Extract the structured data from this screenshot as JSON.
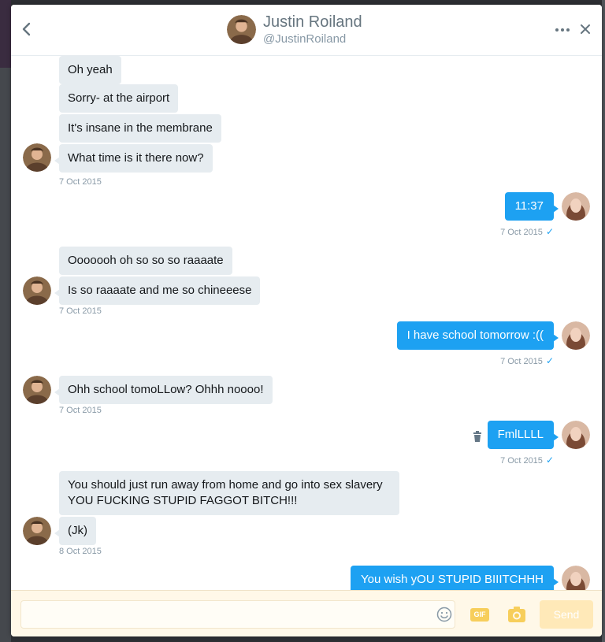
{
  "header": {
    "name": "Justin Roiland",
    "handle": "@JustinRoiland"
  },
  "icons": {
    "back": "chevron-left-icon",
    "more": "more-dots-icon",
    "close": "close-icon",
    "delete": "trash-icon",
    "emoji": "emoji-icon",
    "gif": "gif-icon",
    "photo": "camera-icon"
  },
  "colors": {
    "sent_bubble": "#1da1f2",
    "received_bubble": "#e6ecf0",
    "composer_bg": "#fff8e8",
    "accent": "#f7ce5b"
  },
  "messages": {
    "m1": "Oh yeah",
    "m2": "Sorry- at the airport",
    "m3": "It's insane in the membrane",
    "m4": "What time is it there now?",
    "m4_time": "7 Oct 2015",
    "m5": "11:37",
    "m5_time": "7 Oct 2015",
    "m6": "Ooooooh oh so so so raaaate",
    "m7": "Is so raaaate and me so chineeese",
    "m7_time": "7 Oct 2015",
    "m8": "I have school tomorrow :((",
    "m8_time": "7 Oct 2015",
    "m9": "Ohh school tomoLLow? Ohhh noooo!",
    "m9_time": "7 Oct 2015",
    "m10": "FmlLLLL",
    "m10_time": "7 Oct 2015",
    "m11_line1": "You should just run away from home and go into sex slavery",
    "m11_line2": "YOU FUCKING STUPID FAGGOT BITCH!!!",
    "m12": "(Jk)",
    "m12_time": "8 Oct 2015",
    "m13": "You wish yOU STUPID BIIITCHHH"
  },
  "composer": {
    "gif_label": "GIF",
    "send_label": "Send"
  }
}
